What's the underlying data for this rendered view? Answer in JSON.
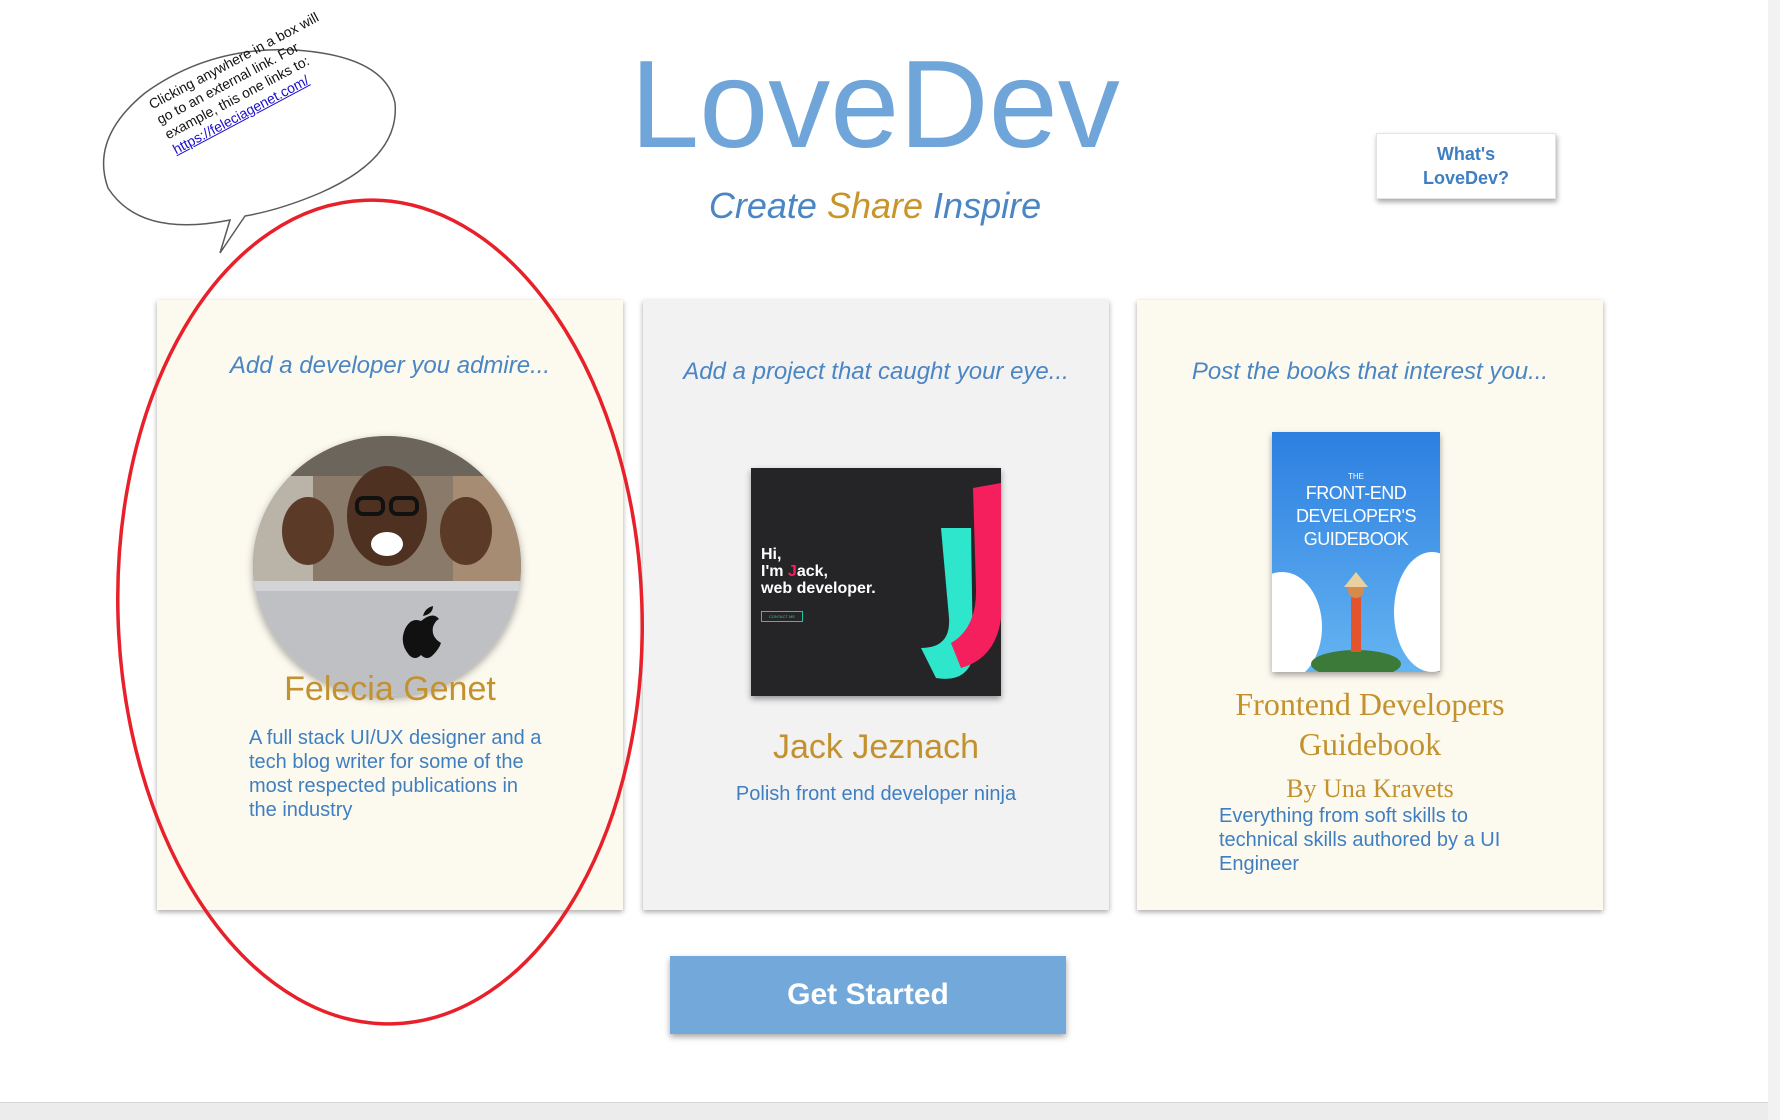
{
  "header": {
    "logo": "LoveDev",
    "tagline": {
      "create": "Create",
      "share": "Share",
      "inspire": "Inspire"
    },
    "whats_button": {
      "line1": "What's",
      "line2": "LoveDev?"
    }
  },
  "annotation": {
    "text": "Clicking anywhere in a box will go to an external link. For example, this one links to:",
    "link": "https://feleciagenet.com/"
  },
  "cards": [
    {
      "heading": "Add a developer you admire...",
      "name": "Felecia Genet",
      "description": "A full stack UI/UX designer and a tech blog writer for some of the most respected publications in the industry",
      "icon": "developer-photo-icon"
    },
    {
      "heading": "Add a project that caught your eye...",
      "name": "Jack Jeznach",
      "description": "Polish front end developer ninja",
      "thumbnail": {
        "line1": "Hi,",
        "line2_prefix": "I'm ",
        "line2_j": "J",
        "line2_suffix": "ack,",
        "line3": "web developer.",
        "button": "CONTACT ME"
      }
    },
    {
      "heading": "Post the books that interest you...",
      "title": "Frontend Developers Guidebook",
      "author": "By Una Kravets",
      "description": "Everything from soft skills to technical skills authored by a UI Engineer",
      "cover": {
        "the": "THE",
        "line1": "FRONT-END",
        "line2": "DEVELOPER'S",
        "line3": "GUIDEBOOK"
      }
    }
  ],
  "cta": {
    "label": "Get Started"
  },
  "colors": {
    "primary_blue": "#6fa5d8",
    "text_blue": "#3f7fc1",
    "gold": "#c3912e",
    "cream": "#fcf9ef",
    "annotation_red": "#e8202a"
  }
}
